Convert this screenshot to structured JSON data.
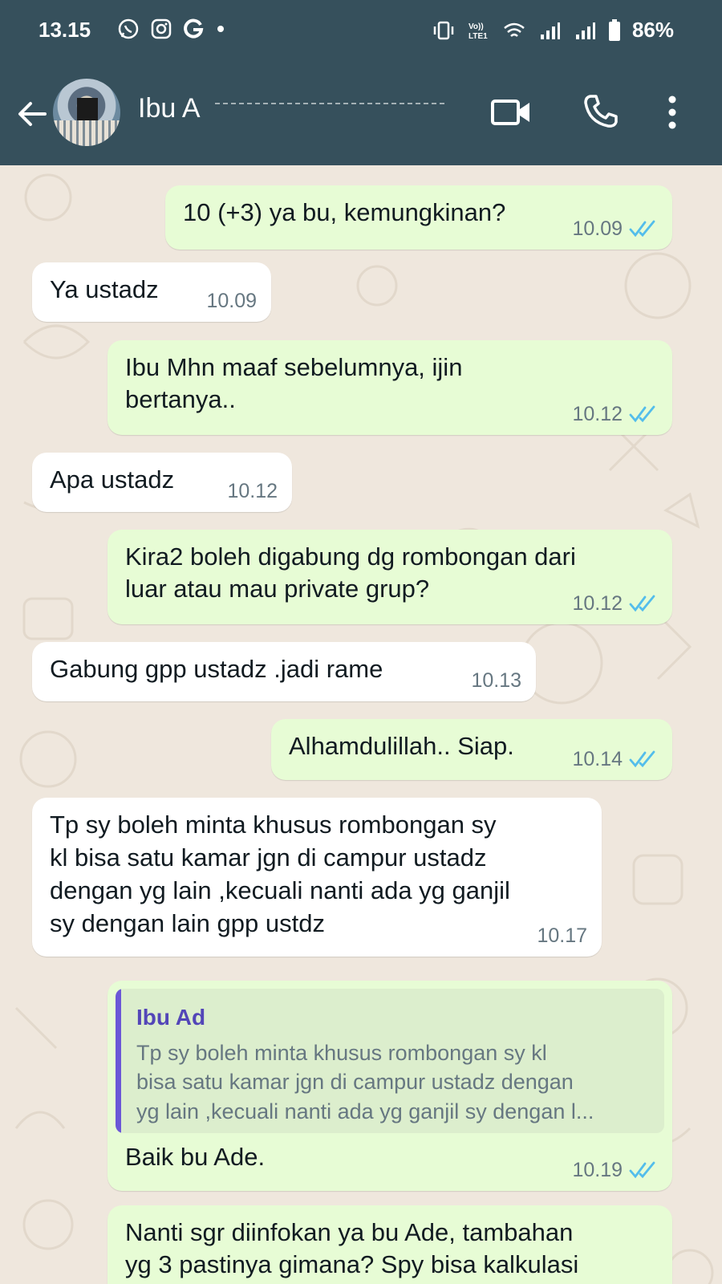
{
  "status_bar": {
    "time": "13.15",
    "battery": "86%",
    "left_icons": [
      "whatsapp-icon",
      "instagram-icon",
      "google-icon",
      "dot-icon"
    ],
    "right_icons": [
      "vibrate-icon",
      "volte-icon",
      "wifi-icon",
      "signal-icon",
      "signal-icon",
      "battery-icon"
    ]
  },
  "header": {
    "contact_name": "Ibu A",
    "icons": [
      "back-arrow-icon",
      "video-call-icon",
      "voice-call-icon",
      "more-options-icon"
    ]
  },
  "messages": [
    {
      "dir": "out",
      "text": "10 (+3) ya bu, kemungkinan?",
      "time": "10.09",
      "read": true
    },
    {
      "dir": "in",
      "text": "Ya ustadz",
      "time": "10.09"
    },
    {
      "dir": "out",
      "text": "Ibu Mhn maaf sebelumnya, ijin\nbertanya..",
      "time": "10.12",
      "read": true
    },
    {
      "dir": "in",
      "text": "Apa ustadz",
      "time": "10.12"
    },
    {
      "dir": "out",
      "text": "Kira2 boleh digabung dg rombongan dari\nluar atau mau private grup?",
      "time": "10.12",
      "read": true
    },
    {
      "dir": "in",
      "text": "Gabung gpp ustadz .jadi rame",
      "time": "10.13"
    },
    {
      "dir": "out",
      "text": "Alhamdulillah.. Siap.",
      "time": "10.14",
      "read": true
    },
    {
      "dir": "in",
      "text": "Tp sy boleh minta khusus rombongan sy\nkl bisa satu kamar jgn di campur ustadz\ndengan yg lain ,kecuali nanti ada yg ganjil\nsy dengan lain gpp ustdz",
      "time": "10.17"
    },
    {
      "dir": "out",
      "text": "Baik bu Ade.",
      "time": "10.19",
      "read": true,
      "quote": {
        "name": "Ibu Ad",
        "text": "Tp sy boleh minta khusus rombongan sy kl\nbisa satu kamar jgn di campur ustadz dengan\nyg lain ,kecuali nanti ada yg ganjil sy dengan l..."
      }
    },
    {
      "dir": "out",
      "text": "Nanti sgr diinfokan ya bu Ade, tambahan\nyg 3 pastinya gimana? Spy bisa kalkulasi",
      "time": ""
    }
  ]
}
